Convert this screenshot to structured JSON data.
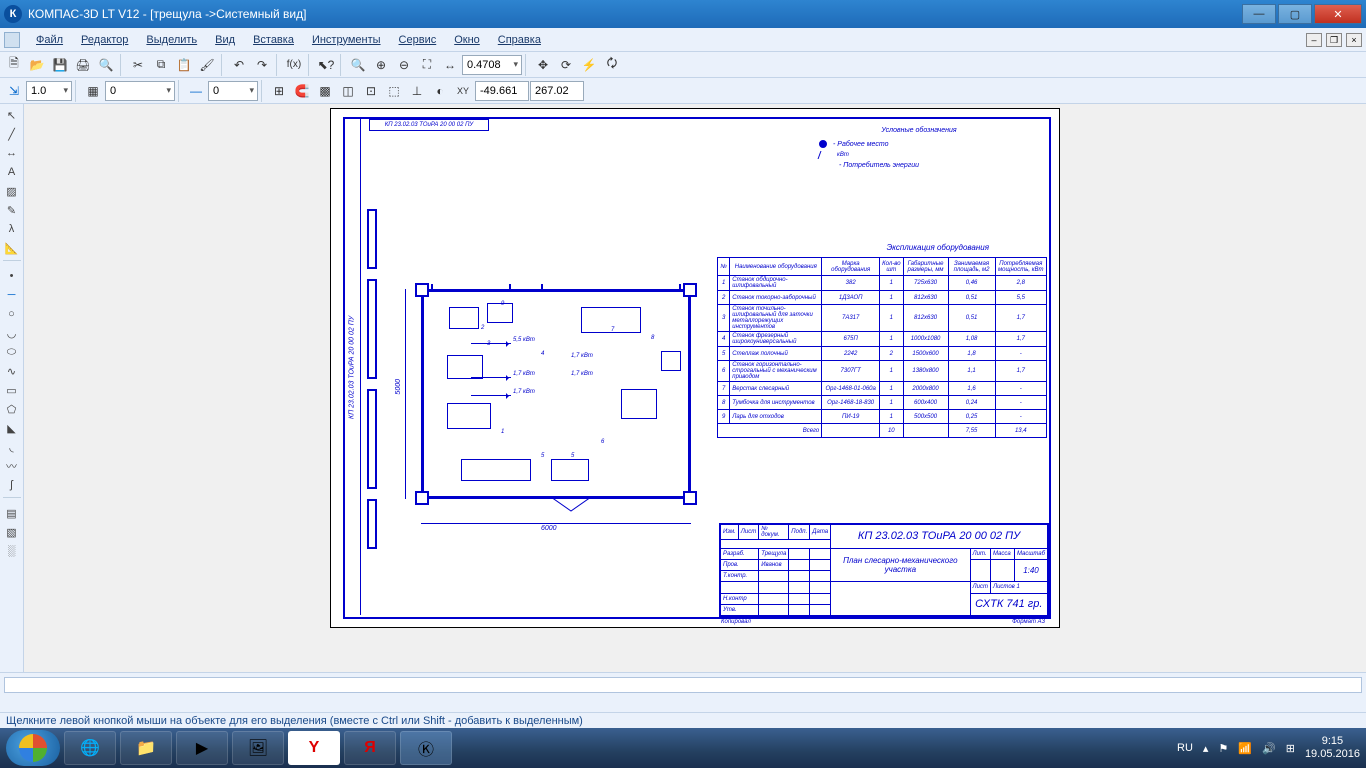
{
  "app": {
    "title": "КОМПАС-3D LT V12 - [трещула ->Системный вид]"
  },
  "menu": {
    "file": "Файл",
    "edit": "Редактор",
    "select": "Выделить",
    "view": "Вид",
    "insert": "Вставка",
    "tools": "Инструменты",
    "service": "Сервис",
    "window": "Окно",
    "help": "Справка"
  },
  "toolbar2": {
    "zoom": "0.4708"
  },
  "toolbar3": {
    "linewidth": "1.0",
    "layer": "0",
    "angle": "0",
    "x": "-49.661",
    "y": "267.02"
  },
  "drawing": {
    "stamp_top": "КП 23.02.03 ТОиРА 20 00 02 ПУ",
    "side_text": "КП 23.02.03 ТОиРА 20 00 02 ПУ",
    "legend_title": "Условные обозначения",
    "legend1": "- Рабочее место",
    "legend2_a": "кВт",
    "legend2": "- Потребитель энергии",
    "eq_title": "Экспликация оборудования",
    "dim_w": "6000",
    "dim_h": "5000",
    "pw": {
      "l1": "5,5 кВт",
      "l2": "1,7 кВт",
      "l3": "1,7 кВт",
      "l4": "1,7 кВт",
      "l5": "1,7 кВт"
    },
    "nums": {
      "n1": "1",
      "n2": "2",
      "n3": "3",
      "n4": "4",
      "n5": "5",
      "n6": "6",
      "n7": "7",
      "n8": "8",
      "n9": "9",
      "n5b": "5"
    }
  },
  "eqtable": {
    "h_num": "№",
    "h_name": "Наименование оборудования",
    "h_mark": "Марка оборудования",
    "h_qty": "Кол-во шт",
    "h_dim": "Габаритные размеры, мм",
    "h_area": "Занимаемая площадь, м2",
    "h_pow": "Потребляемая мощность, кВт",
    "rows": [
      {
        "n": "1",
        "name": "Станок обдирочно-шлифовальный",
        "mark": "382",
        "qty": "1",
        "dim": "725х630",
        "area": "0,46",
        "pow": "2,8"
      },
      {
        "n": "2",
        "name": "Станок токорно-заборочный",
        "mark": "1Д3АОП",
        "qty": "1",
        "dim": "812х630",
        "area": "0,51",
        "pow": "5,5"
      },
      {
        "n": "3",
        "name": "Станок точильно-шлифовальный для заточки металлорежущих инструментов",
        "mark": "7А317",
        "qty": "1",
        "dim": "812х630",
        "area": "0,51",
        "pow": "1,7"
      },
      {
        "n": "4",
        "name": "Станок фрезерный широкоуниверсальный",
        "mark": "675П",
        "qty": "1",
        "dim": "1000х1080",
        "area": "1,08",
        "pow": "1,7"
      },
      {
        "n": "5",
        "name": "Стеллаж полочный",
        "mark": "2242",
        "qty": "2",
        "dim": "1500х600",
        "area": "1,8",
        "pow": "-"
      },
      {
        "n": "6",
        "name": "Станок горизонтально-строгальный с механическим приводом",
        "mark": "7307ГТ",
        "qty": "1",
        "dim": "1380х800",
        "area": "1,1",
        "pow": "1,7"
      },
      {
        "n": "7",
        "name": "Верстак слесарный",
        "mark": "Орг-1468-01-060а",
        "qty": "1",
        "dim": "2000х800",
        "area": "1,6",
        "pow": "-"
      },
      {
        "n": "8",
        "name": "Тумбочка для инструментов",
        "mark": "Орг-1468-18-830",
        "qty": "1",
        "dim": "600х400",
        "area": "0,24",
        "pow": "-"
      },
      {
        "n": "9",
        "name": "Ларь для отходов",
        "mark": "ПИ-19",
        "qty": "1",
        "dim": "500х500",
        "area": "0,25",
        "pow": "-"
      }
    ],
    "total": "Всего",
    "t_qty": "10",
    "t_area": "7,55",
    "t_pow": "13,4"
  },
  "titleblock": {
    "code": "КП 23.02.03 ТОиРА 20 00 02 ПУ",
    "name": "План слесарно-механического участка",
    "scale_lbl": "Масштаб",
    "scale": "1:40",
    "lit": "Лит.",
    "mass": "Масса",
    "sheet": "Лист",
    "sheets": "Листов   1",
    "org": "СХТК 741 гр.",
    "roles": {
      "izm": "Изм.",
      "list": "Лист",
      "ndoc": "№ докум.",
      "podp": "Подп.",
      "data": "Дата",
      "razrab": "Разраб.",
      "prov": "Пров.",
      "tkontr": "Т.контр.",
      "nkontr": "Н.контр",
      "utv": "Утв."
    },
    "dev": "Трещула",
    "chk": "Иванов",
    "kopir": "Копировал",
    "format": "Формат    А3"
  },
  "status": {
    "hint": "Щелкните левой кнопкой мыши на объекте для его выделения (вместе с Ctrl или Shift - добавить к выделенным)"
  },
  "taskbar": {
    "lang": "RU",
    "time": "9:15",
    "date": "19.05.2016"
  }
}
